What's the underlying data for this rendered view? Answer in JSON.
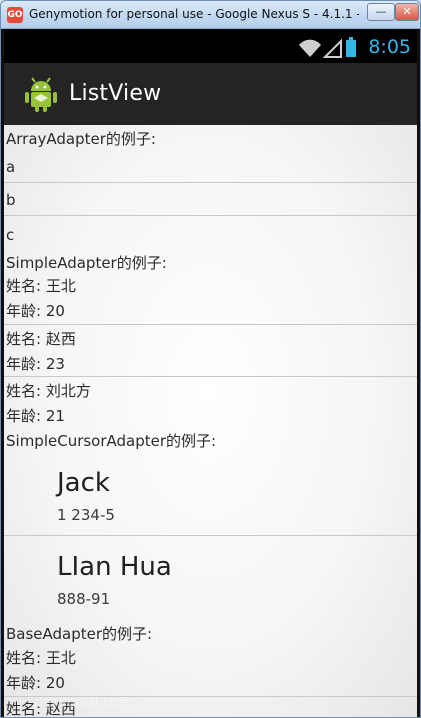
{
  "window": {
    "title": "Genymotion for personal use - Google Nexus S - 4.1.1 - ...",
    "app_icon_text": "GO",
    "minimize_symbol": "—",
    "close_symbol": "✕"
  },
  "status_bar": {
    "time": "8:05",
    "icons": [
      "wifi-icon",
      "signal-icon",
      "battery-icon"
    ],
    "accent_color": "#33b5e5"
  },
  "action_bar": {
    "title": "ListView",
    "icon": "android-icon"
  },
  "sections": {
    "array_adapter": {
      "title": "ArrayAdapter的例子:",
      "items": [
        "a",
        "b",
        "c"
      ]
    },
    "simple_adapter": {
      "title": "SimpleAdapter的例子:",
      "items": [
        {
          "name_line": "姓名:  王北",
          "age_line": "年龄:  20"
        },
        {
          "name_line": "姓名:  赵西",
          "age_line": "年龄:  23"
        },
        {
          "name_line": "姓名:  刘北方",
          "age_line": "年龄:  21"
        }
      ]
    },
    "simple_cursor_adapter": {
      "title": "SimpleCursorAdapter的例子:",
      "items": [
        {
          "name": "Jack",
          "number": "1 234-5"
        },
        {
          "name": "LIan Hua",
          "number": "888-91"
        }
      ]
    },
    "base_adapter": {
      "title": "BaseAdapter的例子:",
      "items": [
        {
          "name_line": "姓名:  王北",
          "age_line": "年龄:  20"
        },
        {
          "name_line": "姓名:  赵西"
        }
      ]
    }
  },
  "watermark": "personal use"
}
